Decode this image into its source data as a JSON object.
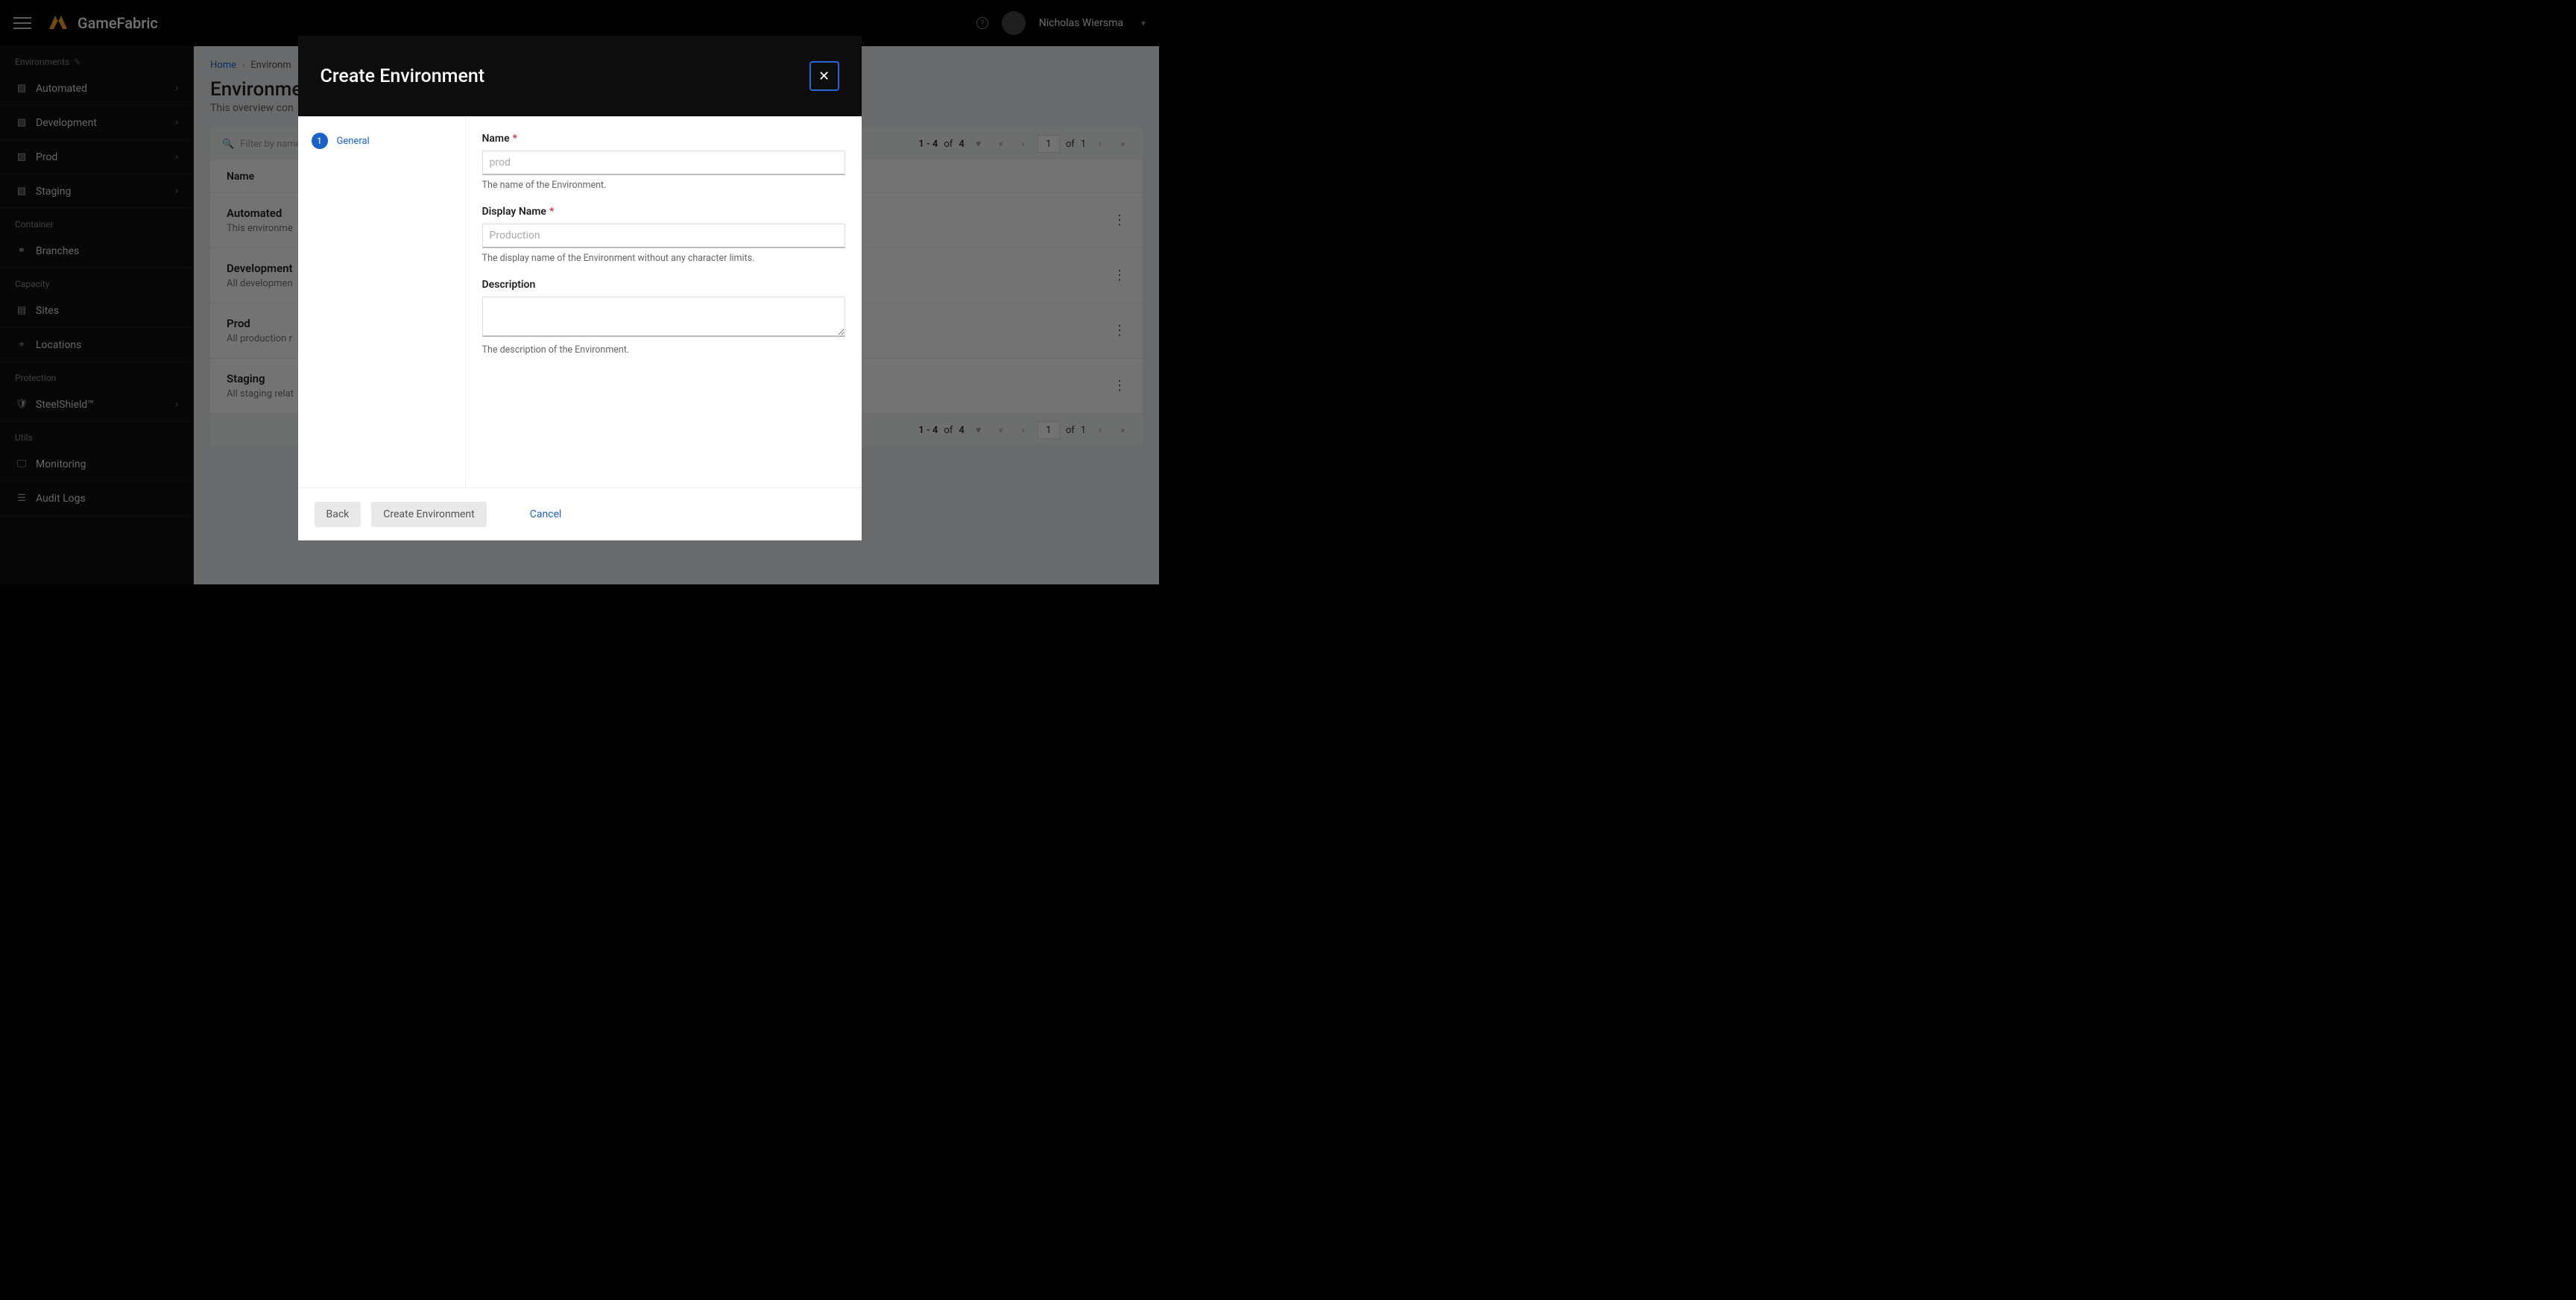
{
  "brand": {
    "name": "GameFabric"
  },
  "topbar": {
    "user": "Nicholas Wiersma"
  },
  "sidebar": {
    "sections": {
      "environments_label": "Environments",
      "container_label": "Container",
      "capacity_label": "Capacity",
      "protection_label": "Protection",
      "utils_label": "Utils"
    },
    "items": {
      "automated": "Automated",
      "development": "Development",
      "prod": "Prod",
      "staging": "Staging",
      "branches": "Branches",
      "sites": "Sites",
      "locations": "Locations",
      "steelshield": "SteelShield™",
      "monitoring": "Monitoring",
      "audit_logs": "Audit Logs"
    }
  },
  "breadcrumb": {
    "home": "Home",
    "current": "Environm"
  },
  "page": {
    "title": "Environmen",
    "subtitle": "This overview con"
  },
  "table": {
    "filter_placeholder": "Filter by name",
    "col_name": "Name",
    "pager": {
      "range": "1 - 4",
      "of_text": "of",
      "total": "4",
      "page": "1",
      "pages": "1"
    },
    "rows": [
      {
        "name": "Automated",
        "desc": "This environme"
      },
      {
        "name": "Development",
        "desc": "All developmen"
      },
      {
        "name": "Prod",
        "desc": "All production r"
      },
      {
        "name": "Staging",
        "desc": "All staging relat"
      }
    ]
  },
  "modal": {
    "title": "Create Environment",
    "step1": {
      "num": "1",
      "label": "General"
    },
    "fields": {
      "name_label": "Name",
      "name_placeholder": "prod",
      "name_help": "The name of the Environment.",
      "display_label": "Display Name",
      "display_placeholder": "Production",
      "display_help": "The display name of the Environment without any character limits.",
      "desc_label": "Description",
      "desc_help": "The description of the Environment."
    },
    "buttons": {
      "back": "Back",
      "create": "Create Environment",
      "cancel": "Cancel"
    }
  }
}
